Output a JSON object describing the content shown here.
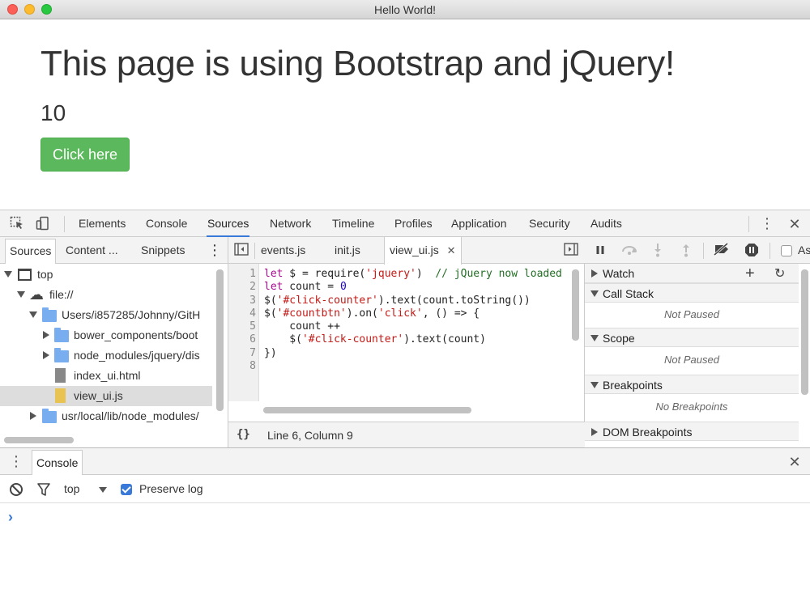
{
  "window": {
    "title": "Hello World!"
  },
  "page": {
    "heading": "This page is using Bootstrap and jQuery!",
    "counter": "10",
    "button_label": "Click here"
  },
  "devtools": {
    "tabs": [
      "Elements",
      "Console",
      "Sources",
      "Network",
      "Timeline",
      "Profiles",
      "Application",
      "Security",
      "Audits"
    ],
    "active_tab": "Sources",
    "navigator": {
      "tabs": [
        "Sources",
        "Content ...",
        "Snippets"
      ],
      "tree": [
        {
          "label": "top"
        },
        {
          "label": "file://"
        },
        {
          "label": "Users/i857285/Johnny/GitH"
        },
        {
          "label": "bower_components/boot"
        },
        {
          "label": "node_modules/jquery/dis"
        },
        {
          "label": "index_ui.html"
        },
        {
          "label": "view_ui.js"
        },
        {
          "label": "usr/local/lib/node_modules/"
        }
      ]
    },
    "editor": {
      "tabs": [
        "events.js",
        "init.js",
        "view_ui.js"
      ],
      "line_numbers": [
        "1",
        "2",
        "3",
        "4",
        "5",
        "6",
        "7",
        "8"
      ],
      "status": "Line 6, Column 9",
      "format_icon": "{}"
    },
    "sidebar": {
      "async_label": "As",
      "sections": {
        "watch": "Watch",
        "call_stack": "Call Stack",
        "call_stack_empty": "Not Paused",
        "scope": "Scope",
        "scope_empty": "Not Paused",
        "breakpoints": "Breakpoints",
        "breakpoints_empty": "No Breakpoints",
        "dom_breakpoints": "DOM Breakpoints"
      }
    },
    "drawer": {
      "tab": "Console",
      "context": "top",
      "preserve_log": "Preserve log",
      "prompt": "›"
    }
  },
  "colors": {
    "accent": "#3879d9",
    "button": "#5cb85c"
  }
}
